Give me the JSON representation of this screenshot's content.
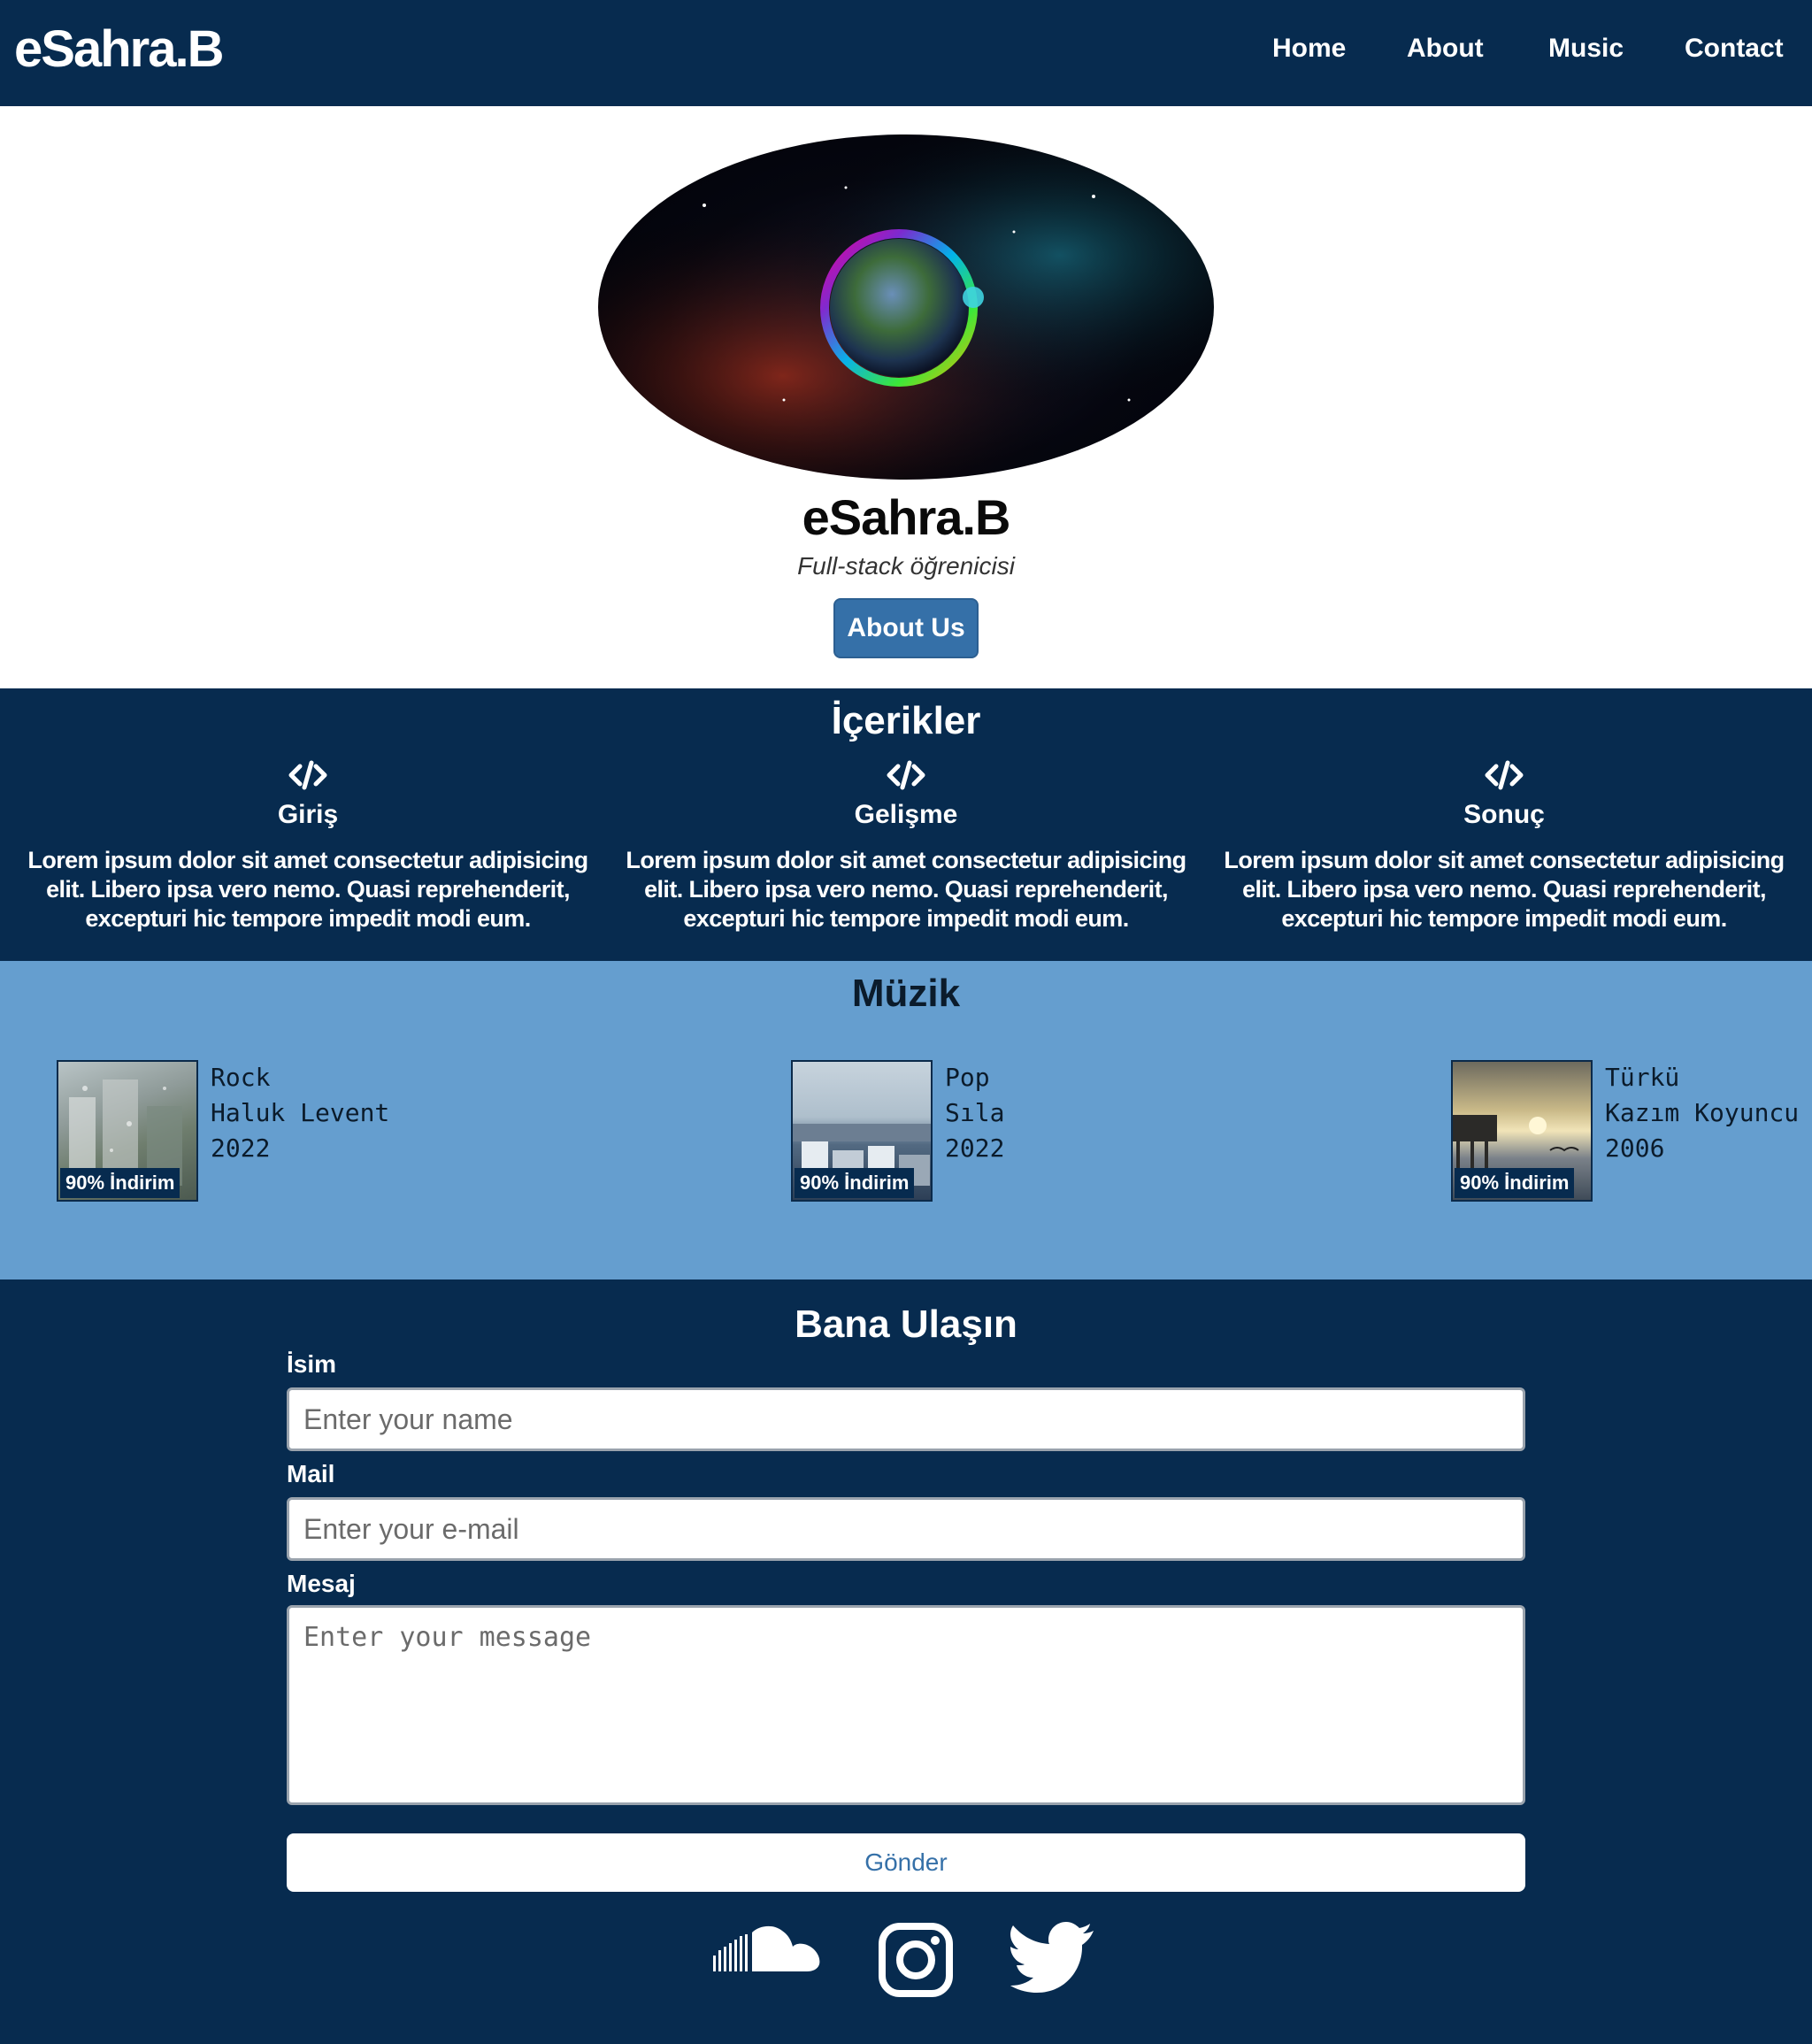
{
  "navbar": {
    "brand": "eSahra.B",
    "items": [
      "Home",
      "About",
      "Music",
      "Contact"
    ]
  },
  "hero": {
    "name": "eSahra.B",
    "role": "Full-stack öğrenicisi",
    "button": "About Us"
  },
  "contents": {
    "title": "İçerikler",
    "columns": [
      {
        "heading": "Giriş",
        "text": "Lorem ipsum dolor sit amet consectetur adipisicing elit. Libero ipsa vero nemo. Quasi reprehenderit, excepturi hic tempore impedit modi eum."
      },
      {
        "heading": "Gelişme",
        "text": "Lorem ipsum dolor sit amet consectetur adipisicing elit. Libero ipsa vero nemo. Quasi reprehenderit, excepturi hic tempore impedit modi eum."
      },
      {
        "heading": "Sonuç",
        "text": "Lorem ipsum dolor sit amet consectetur adipisicing elit. Libero ipsa vero nemo. Quasi reprehenderit, excepturi hic tempore impedit modi eum."
      }
    ],
    "icon": "code-icon"
  },
  "music": {
    "title": "Müzik",
    "cards": [
      {
        "genre": "Rock",
        "artist": "Haluk Levent",
        "year": "2022",
        "badge": "90% İndirim"
      },
      {
        "genre": "Pop",
        "artist": "Sıla",
        "year": "2022",
        "badge": "90% İndirim"
      },
      {
        "genre": "Türkü",
        "artist": "Kazım Koyuncu",
        "year": "2006",
        "badge": "90% İndirim"
      }
    ]
  },
  "contact": {
    "title": "Bana Ulaşın",
    "name_label": "İsim",
    "name_placeholder": "Enter your name",
    "mail_label": "Mail",
    "mail_placeholder": "Enter your e-mail",
    "message_label": "Mesaj",
    "message_placeholder": "Enter your message",
    "submit": "Gönder"
  },
  "social": [
    "soundcloud-icon",
    "instagram-icon",
    "twitter-icon"
  ],
  "colors": {
    "navy": "#072b4f",
    "music_bg": "#659ecf",
    "button": "#3570a8"
  }
}
